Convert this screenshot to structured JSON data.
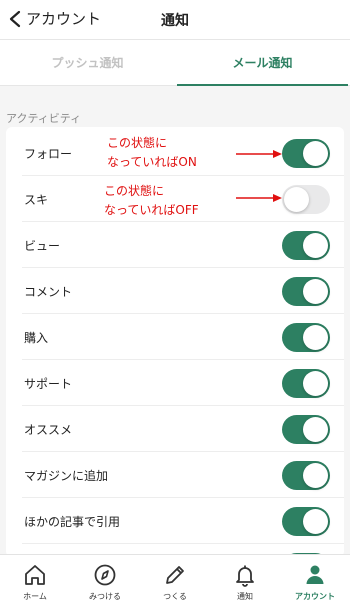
{
  "header": {
    "back_label": "アカウント",
    "title": "通知"
  },
  "tabs": [
    {
      "label": "プッシュ通知",
      "active": false
    },
    {
      "label": "メール通知",
      "active": true
    }
  ],
  "section_label": "アクティビティ",
  "settings": [
    {
      "label": "フォロー",
      "enabled": true
    },
    {
      "label": "スキ",
      "enabled": false
    },
    {
      "label": "ビュー",
      "enabled": true
    },
    {
      "label": "コメント",
      "enabled": true
    },
    {
      "label": "購入",
      "enabled": true
    },
    {
      "label": "サポート",
      "enabled": true
    },
    {
      "label": "オススメ",
      "enabled": true
    },
    {
      "label": "マガジンに追加",
      "enabled": true
    },
    {
      "label": "ほかの記事で引用",
      "enabled": true
    }
  ],
  "annotations": {
    "on": {
      "line1": "この状態に",
      "line2": "なっていればON"
    },
    "off": {
      "line1": "この状態に",
      "line2": "なっていればOFF"
    }
  },
  "bottom_nav": [
    {
      "label": "ホーム",
      "icon": "home-icon",
      "active": false
    },
    {
      "label": "みつける",
      "icon": "compass-icon",
      "active": false
    },
    {
      "label": "つくる",
      "icon": "pencil-icon",
      "active": false
    },
    {
      "label": "通知",
      "icon": "bell-icon",
      "active": false
    },
    {
      "label": "アカウント",
      "icon": "person-icon",
      "active": true
    }
  ],
  "colors": {
    "accent": "#2d8062",
    "toggle_off": "#e9e9ea",
    "annotation": "#e01010"
  }
}
